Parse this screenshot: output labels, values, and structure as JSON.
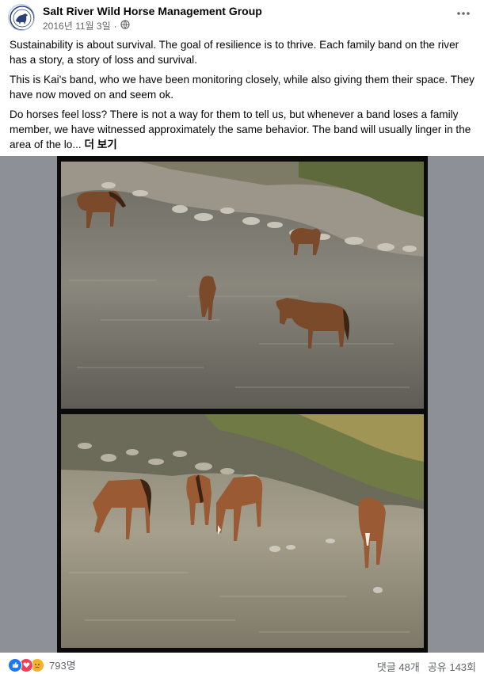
{
  "post": {
    "page_name": "Salt River Wild Horse Management Group",
    "date": "2016년 11월 3일",
    "separator": "·",
    "privacy_icon": "globe-icon",
    "more_icon": "more-options-icon",
    "paragraphs": [
      "Sustainability is about survival. The goal of resilience is to thrive. Each family band on the river has a story, a story of loss and survival.",
      "This is Kai's band, who we have been monitoring closely, while also giving them their space. They have now moved on and seem ok.",
      "Do horses feel loss? There is not a way for them to tell us, but whenever a band loses a family member, we have witnessed approximately the same behavior. The band will usually linger in the area of the lo..."
    ],
    "see_more": "더 보기"
  },
  "photos": [
    {
      "subject": "horses standing in river, upper photo"
    },
    {
      "subject": "horses drinking in river, lower photo"
    }
  ],
  "footer": {
    "reaction_icons": [
      "like-icon",
      "love-icon",
      "sad-icon"
    ],
    "reaction_count": "793명",
    "comments": "댓글 48개",
    "shares": "공유 143회"
  },
  "colors": {
    "primary_text": "#050505",
    "secondary_text": "#65676b",
    "like": "#1877f2",
    "love": "#f33e58",
    "sad": "#f7b125"
  }
}
